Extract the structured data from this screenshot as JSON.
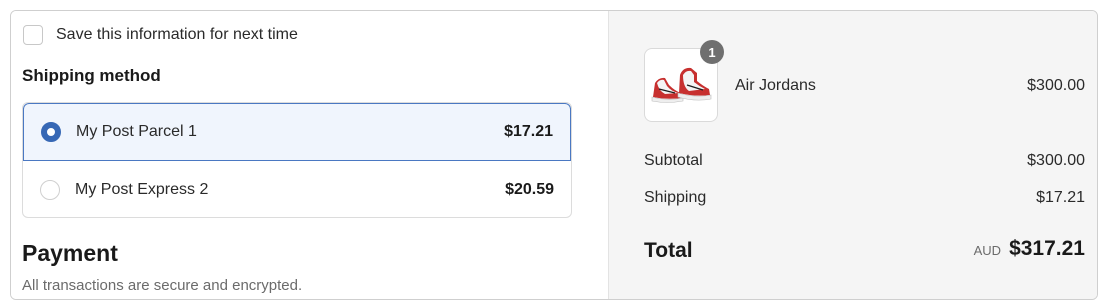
{
  "contact": {
    "save_info_label": "Save this information for next time",
    "save_info_checked": false
  },
  "shipping": {
    "heading": "Shipping method",
    "options": [
      {
        "label": "My Post Parcel 1",
        "price": "$17.21",
        "selected": true
      },
      {
        "label": "My Post Express 2",
        "price": "$20.59",
        "selected": false
      }
    ]
  },
  "payment": {
    "heading": "Payment",
    "subtitle": "All transactions are secure and encrypted."
  },
  "order_summary": {
    "items": [
      {
        "name": "Air Jordans",
        "price": "$300.00",
        "quantity": "1",
        "thumbnail_icon": "sneaker-icon"
      }
    ],
    "subtotal_label": "Subtotal",
    "subtotal_value": "$300.00",
    "shipping_label": "Shipping",
    "shipping_value": "$17.21",
    "total_label": "Total",
    "currency": "AUD",
    "total_value": "$317.21"
  },
  "colors": {
    "accent": "#3768b5",
    "selected_background": "#f0f5fd",
    "summary_background": "#f5f5f5"
  }
}
